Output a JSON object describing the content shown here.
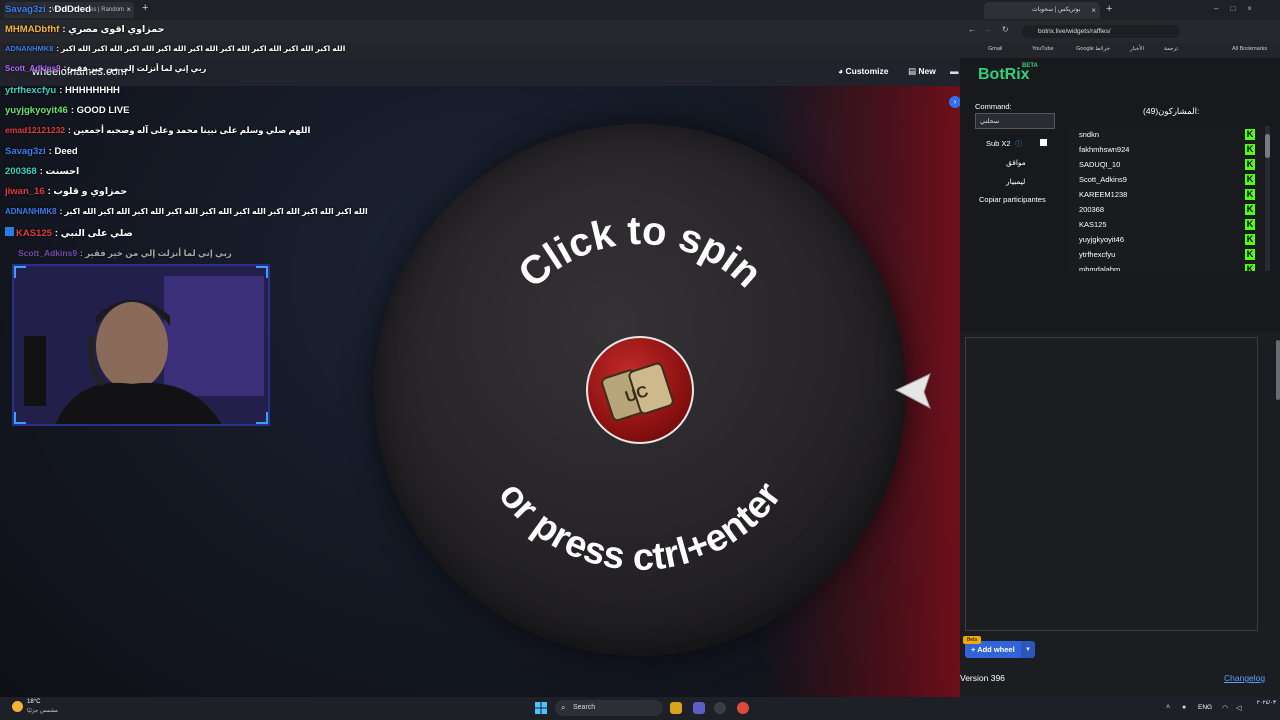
{
  "left_browser": {
    "tab_title": "Wheel of Names | Random name",
    "tab_close": "×",
    "new_tab": "+",
    "site_logo": "wheelofnames.com",
    "toolbar": {
      "customize": "Customize",
      "new": "New"
    }
  },
  "wheel": {
    "top_text": "Click to spin",
    "bottom_text": "or press ctrl+enter",
    "center_text": "UC"
  },
  "chat": [
    {
      "user": "Savag3zi",
      "user_color": "#3d7cf0",
      "message": "DdDded"
    },
    {
      "user": "MHMADbfhf",
      "user_color": "#f4b43b",
      "message": "حمزاوي اقوى مصري"
    },
    {
      "user": "ADNANHMK8",
      "user_color": "#3d7cf0",
      "message": "الله اكبر الله اكبر الله اكبر الله اكبر الله اكبر الله اكبر الله اكبر الله اكبر الله اكبر"
    },
    {
      "user": "Scott_Adkins9",
      "user_color": "#b46bff",
      "message": "ربي إني لما أنزلت إلي من خير فقير"
    },
    {
      "user": "ytrfhexcfyu",
      "user_color": "#3fd0c4",
      "message": "HHHHHHHH"
    },
    {
      "user": "yuyjgkyoyit46",
      "user_color": "#6ee36e",
      "message": "GOOD LIVE"
    },
    {
      "user": "emad12121232",
      "user_color": "#e23b3b",
      "message": "اللهم صلي وسلم على نبينا محمد وعلى آله وصحبه أجمعين"
    },
    {
      "user": "Savag3zi",
      "user_color": "#3d7cf0",
      "message": "Deed"
    },
    {
      "user": "200368",
      "user_color": "#3fd0c4",
      "message": "احسنت"
    },
    {
      "user": "jiwan_16",
      "user_color": "#e23b3b",
      "message": "حمزاوي و قلوب"
    },
    {
      "user": "ADNANHMK8",
      "user_color": "#3d7cf0",
      "message": "الله اكبر الله اكبر الله اكبر الله اكبر الله اكبر الله اكبر الله اكبر الله اكبر الله اكبر"
    },
    {
      "user": "KAS125",
      "user_color": "#e23b3b",
      "message": "صلي على النبي"
    },
    {
      "user": "Scott_Adkins9",
      "user_color": "#b46bff",
      "message": "ربي إني لما أنزلت إلي من خير فقير"
    }
  ],
  "right_browser": {
    "tab_title": "بوتريكس | سحوبات",
    "tab_close": "×",
    "new_tab": "+",
    "url": "botrix.live/widgets/raffles/",
    "bookmarks": [
      "Gmail",
      "YouTube",
      "Google خرائط",
      "الأخبار",
      "ترجمة",
      "All Bookmarks"
    ],
    "logo": "BotRix",
    "logo_beta": "BETA",
    "command_label": "Command:",
    "command_value": "سحلني",
    "sub_x2": "Sub X2",
    "sub_x2_info": "ⓘ",
    "btn_agree": "موافق",
    "btn_clear": "ليمبيار",
    "btn_copy": "Copiar participantes",
    "participants_title": "المشاركون(49):",
    "participants": [
      "sndkn",
      "fakhmhswn924",
      "SADUQI_10",
      "Scott_Adkins9",
      "KAREEM1238",
      "200368",
      "KAS125",
      "yuyjgkyoyit46",
      "ytrfhexcfyu",
      "mhmdalahm"
    ],
    "add_wheel": "Add wheel",
    "add_wheel_beta": "Beta",
    "version": "Version 396",
    "changelog": "Changelog"
  },
  "taskbar": {
    "weather_temp": "18°C",
    "weather_desc": "مشمس جزئيًا",
    "search": "Search",
    "language": "ENG",
    "clock": "٢٠٢٤/٠٣"
  },
  "colors": {
    "accent_blue": "#3164d9",
    "botrix_green": "#35d07a",
    "kick_green": "#53fc18",
    "wheel_red": "#8c1111"
  }
}
